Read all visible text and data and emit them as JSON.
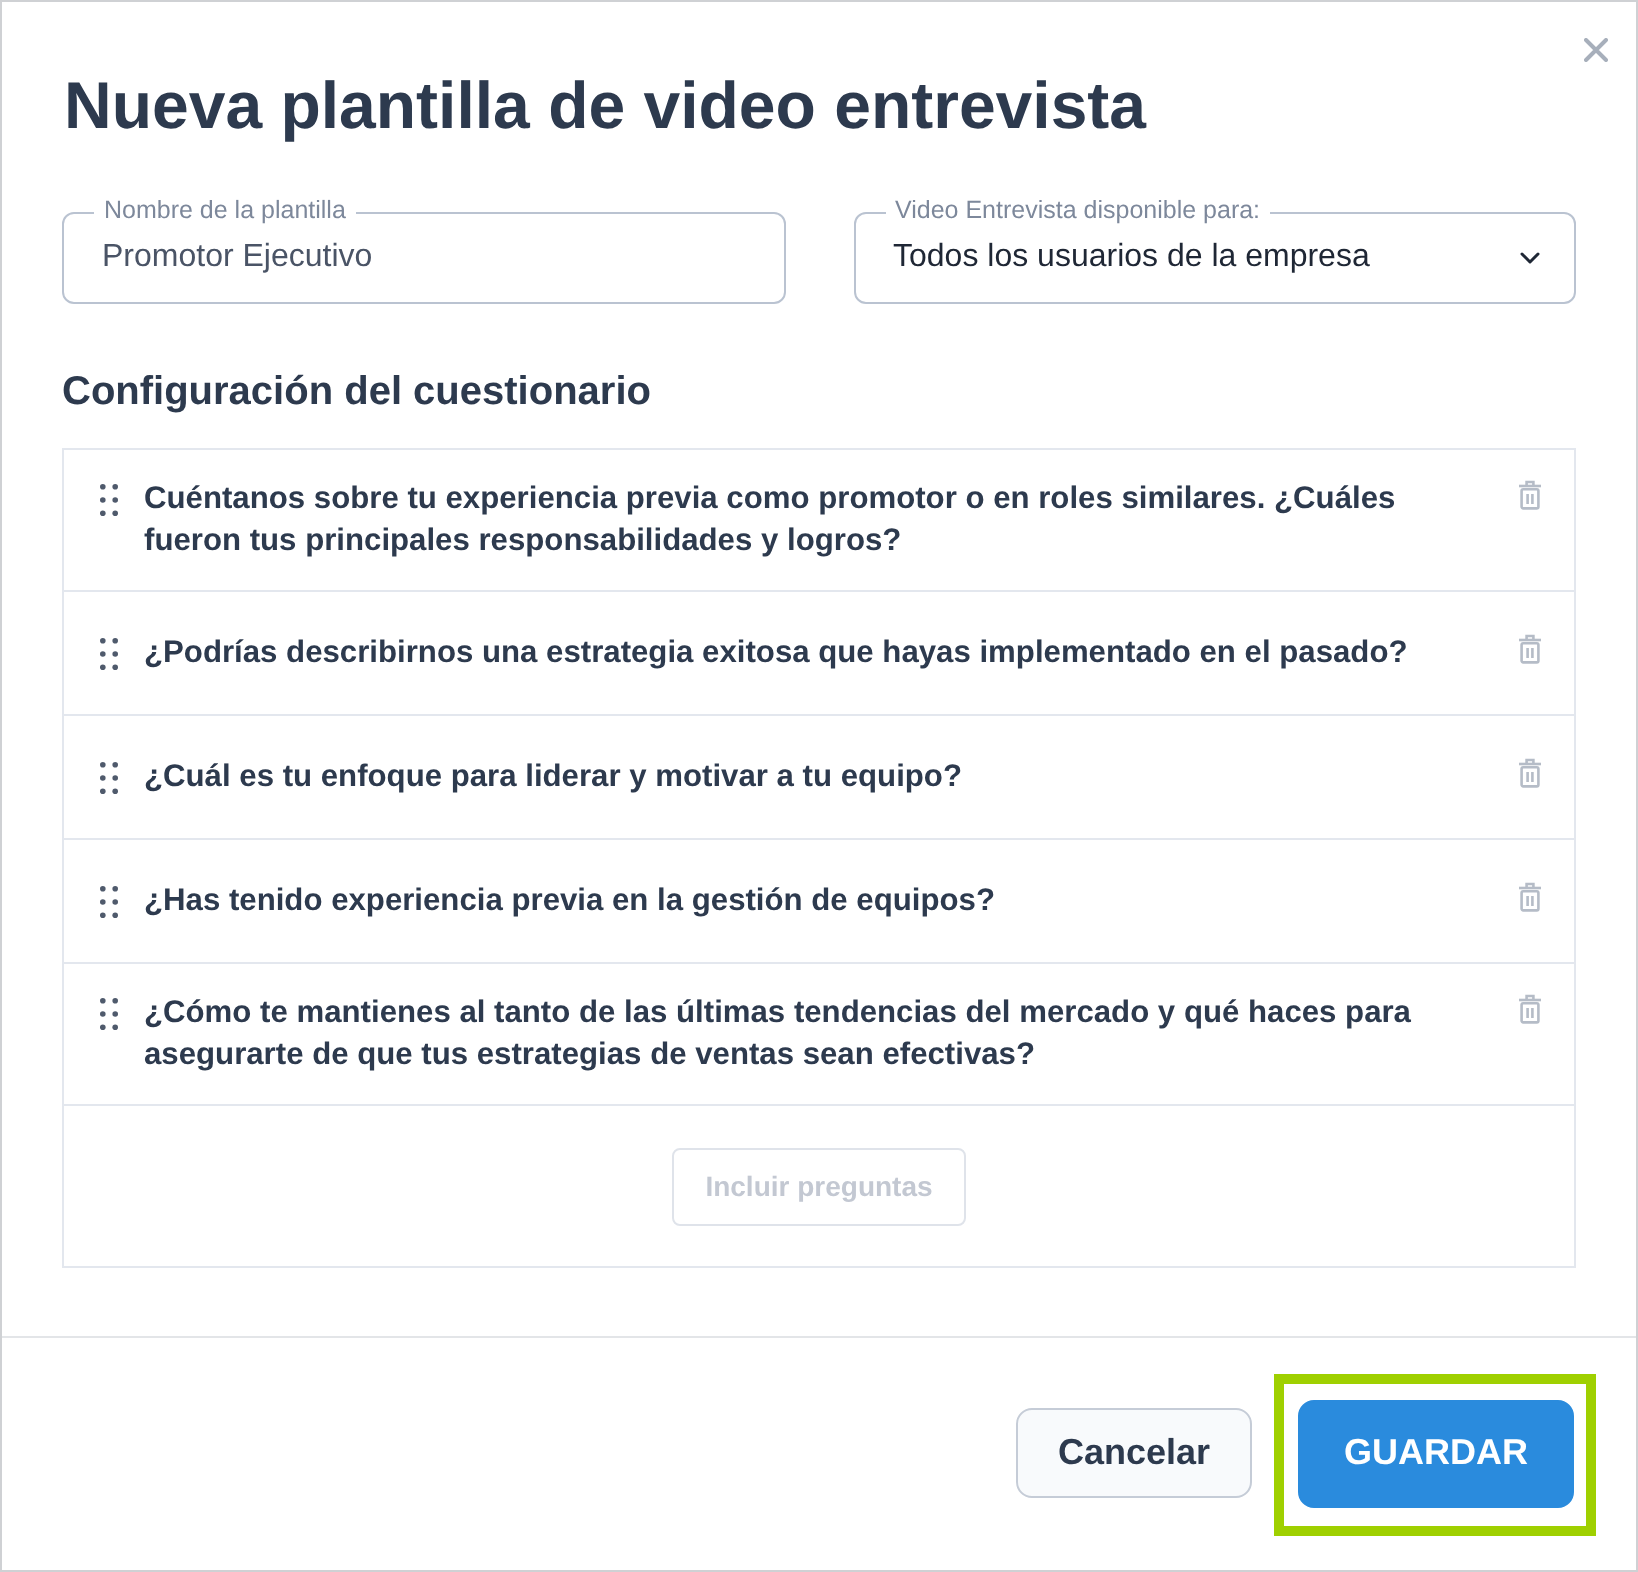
{
  "dialog": {
    "title": "Nueva plantilla de video entrevista"
  },
  "fields": [
    {
      "kind": "text",
      "label": "Nombre de la plantilla",
      "value": "Promotor Ejecutivo"
    },
    {
      "kind": "select",
      "label": "Video Entrevista disponible para:",
      "value": "Todos los usuarios de la empresa"
    }
  ],
  "questionnaire": {
    "heading": "Configuración del cuestionario",
    "questions": [
      {
        "text": "Cuéntanos sobre tu experiencia previa como promotor o en roles similares. ¿Cuáles fueron tus principales responsabilidades y logros?"
      },
      {
        "text": "¿Podrías describirnos una estrategia exitosa que hayas implementado en el pasado?"
      },
      {
        "text": "¿Cuál es tu enfoque para liderar y motivar a tu equipo?"
      },
      {
        "text": "¿Has tenido experiencia previa en la gestión de equipos?"
      },
      {
        "text": "¿Cómo te mantienes al tanto de las últimas tendencias del mercado y qué haces para asegurarte de que tus estrategias de ventas sean efectivas?"
      }
    ],
    "add_button": {
      "label": "Incluir preguntas",
      "disabled": true
    }
  },
  "footer": {
    "buttons": [
      {
        "kind": "secondary",
        "label": "Cancelar",
        "highlighted": false
      },
      {
        "kind": "primary",
        "label": "GUARDAR",
        "highlighted": true
      }
    ]
  }
}
